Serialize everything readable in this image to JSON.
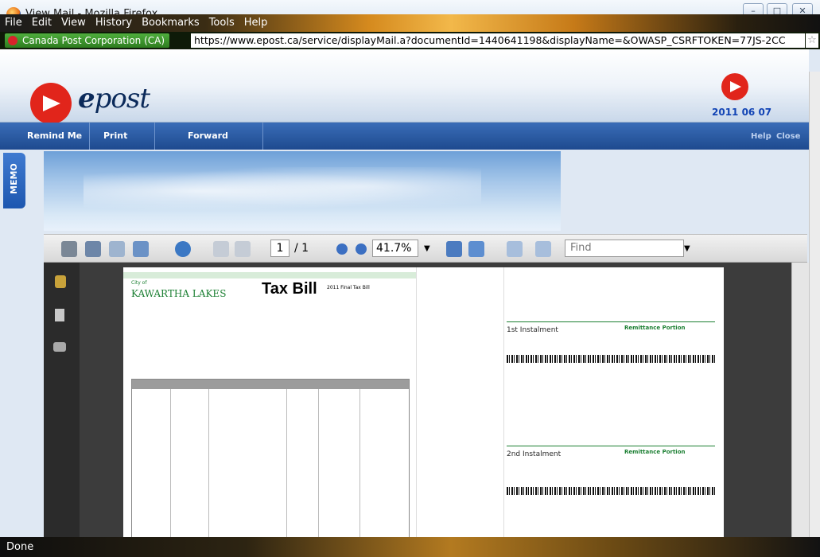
{
  "window": {
    "title": "View Mail - Mozilla Firefox"
  },
  "menu": [
    "File",
    "Edit",
    "View",
    "History",
    "Bookmarks",
    "Tools",
    "Help"
  ],
  "address": {
    "site_identity": "Canada Post Corporation (CA)",
    "url": "https://www.epost.ca/service/displayMail.a?documentId=1440641198&displayName=&OWASP_CSRFTOKEN=77JS-2CC"
  },
  "epost": {
    "brand": "post",
    "brand_prefix": "e",
    "date": "2011 06 07"
  },
  "nav": {
    "items": [
      "Remind Me",
      "Print",
      "Forward"
    ],
    "help": "Help",
    "close": "Close"
  },
  "memo": {
    "label": "MEMO"
  },
  "pdf_toolbar": {
    "page": "1",
    "page_total": "/ 1",
    "zoom": "41.7%",
    "find_placeholder": "Find"
  },
  "document": {
    "city": "KAWARTHA LAKES",
    "city_prefix": "City of",
    "title": "Tax Bill",
    "subtitle": "2011 Final Tax Bill",
    "installment1": "1st Instalment",
    "installment2": "2nd Instalment",
    "remittance": "Remittance Portion"
  },
  "status": {
    "text": "Done"
  }
}
